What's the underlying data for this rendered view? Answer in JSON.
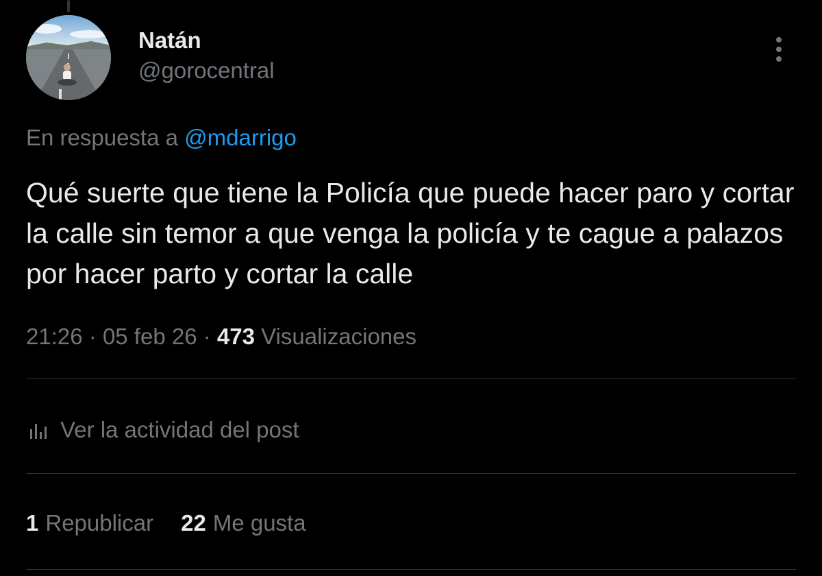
{
  "author": {
    "display_name": "Natán",
    "handle": "@gorocentral"
  },
  "reply": {
    "prefix": "En respuesta a",
    "mention": "@mdarrigo"
  },
  "tweet": {
    "text": "Qué suerte que tiene la Policía que puede hacer paro y cortar la calle sin temor a que venga la policía y te cague a palazos por hacer parto y cortar la calle"
  },
  "meta": {
    "time": "21:26",
    "separator": "·",
    "date": "05 feb 26",
    "views_count": "473",
    "views_label": "Visualizaciones"
  },
  "activity": {
    "label": "Ver la actividad del post",
    "icon": "analytics-bars-icon"
  },
  "stats": {
    "reposts_count": "1",
    "reposts_label": "Republicar",
    "likes_count": "22",
    "likes_label": "Me gusta"
  },
  "colors": {
    "background": "#000000",
    "primary_text": "#e7e9ea",
    "secondary_text": "#71767b",
    "link": "#1d9bf0",
    "divider": "#2f3336"
  }
}
